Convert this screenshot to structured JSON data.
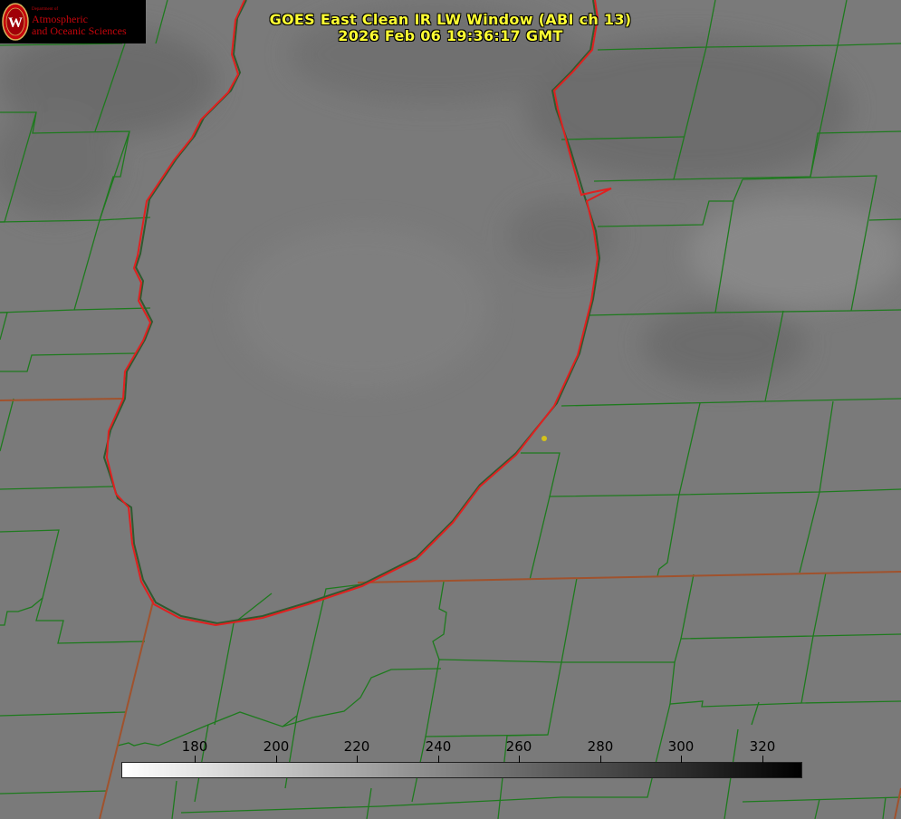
{
  "title": {
    "line1": "GOES East Clean IR LW Window (ABI ch 13)",
    "line2": "2026 Feb 06 19:36:17 GMT"
  },
  "logo": {
    "dept": "Department of",
    "line1": "Atmospheric",
    "line2": "and Oceanic Sciences",
    "color": "#c5050c"
  },
  "colorbar": {
    "ticks": [
      "180",
      "200",
      "220",
      "240",
      "260",
      "280",
      "300",
      "320"
    ],
    "scale": "white-to-black grayscale"
  },
  "colors": {
    "county_lines": "#1e7a1e",
    "state_lines": "#c0392b",
    "lake_outline": "#e02020",
    "title_text": "#ffff33",
    "marker": "#d4c21a"
  }
}
